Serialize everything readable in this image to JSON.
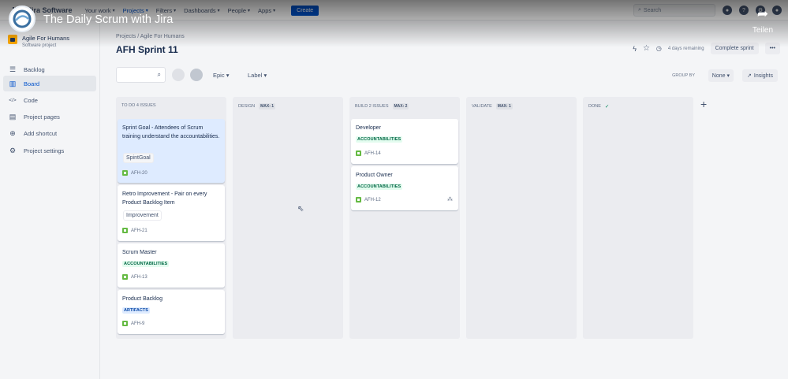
{
  "topnav": {
    "brand": "Jira Software",
    "items": [
      {
        "label": "Your work"
      },
      {
        "label": "Projects"
      },
      {
        "label": "Filters"
      },
      {
        "label": "Dashboards"
      },
      {
        "label": "People"
      },
      {
        "label": "Apps"
      }
    ],
    "create": "Create",
    "search_placeholder": "Search"
  },
  "video": {
    "title": "The Daily Scrum with Jira",
    "share": "Teilen"
  },
  "sidebar": {
    "project_name": "Agile For Humans",
    "project_type": "Software project",
    "items": [
      {
        "label": "Backlog",
        "icon": "backlog-icon",
        "glyph": "☰"
      },
      {
        "label": "Board",
        "icon": "board-icon",
        "glyph": "▥"
      },
      {
        "label": "Code",
        "icon": "code-icon",
        "glyph": "</>"
      },
      {
        "label": "Project pages",
        "icon": "pages-icon",
        "glyph": "▤"
      },
      {
        "label": "Add shortcut",
        "icon": "shortcut-icon",
        "glyph": "⊕"
      },
      {
        "label": "Project settings",
        "icon": "gear-icon",
        "glyph": "⚙"
      }
    ]
  },
  "header": {
    "breadcrumb": "Projects / Agile For Humans",
    "title": "AFH Sprint 11",
    "remaining": "4 days remaining",
    "complete_sprint": "Complete sprint",
    "more": "•••"
  },
  "filters": {
    "epic": "Epic",
    "label": "Label",
    "group_by": "GROUP BY",
    "group_value": "None",
    "insights": "Insights"
  },
  "columns": [
    {
      "name": "TO DO 4 ISSUES",
      "max": ""
    },
    {
      "name": "DESIGN",
      "max": "MAX: 1"
    },
    {
      "name": "BUILD 2 ISSUES",
      "max": "MAX: 2"
    },
    {
      "name": "VALIDATE",
      "max": "MAX: 1"
    },
    {
      "name": "DONE",
      "max": ""
    }
  ],
  "cards": [
    {
      "title": "Sprint Goal - Attendees of Scrum training understand the accountabilities.",
      "tag": "SpintGoal",
      "key": "AFH-20"
    },
    {
      "title": "Retro Improvement - Pair on every Product Backlog Item",
      "tag": "Improvement",
      "key": "AFH-21"
    },
    {
      "title": "Scrum Master",
      "tag": "ACCOUNTABILITIES",
      "key": "AFH-13"
    },
    {
      "title": "Product Backlog",
      "tag": "ARTIFACTS",
      "key": "AFH-9"
    },
    {
      "title": "Developer",
      "tag": "ACCOUNTABILITIES",
      "key": "AFH-14"
    },
    {
      "title": "Product Owner",
      "tag": "ACCOUNTABILITIES",
      "key": "AFH-12"
    }
  ],
  "colors": {
    "accent": "#0052cc",
    "selected_card": "#deebff",
    "story": "#65ba43"
  }
}
